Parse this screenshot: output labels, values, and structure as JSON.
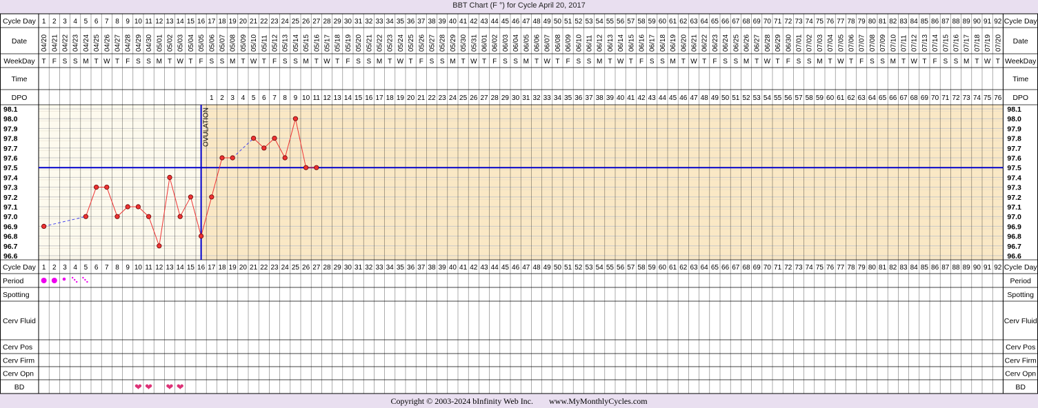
{
  "title": "BBT Chart (F °) for Cycle April 20, 2017",
  "footer": {
    "copyright": "Copyright © 2003-2024 bInfinity Web Inc.",
    "site": "www.MyMonthlyCycles.com"
  },
  "row_labels": {
    "cycle_day": "Cycle Day",
    "date": "Date",
    "weekday": "WeekDay",
    "time": "Time",
    "dpo": "DPO",
    "period": "Period",
    "spotting": "Spotting",
    "cerv_fluid": "Cerv Fluid",
    "cerv_pos": "Cerv Pos",
    "cerv_firm": "Cerv Firm",
    "cerv_opn": "Cerv Opn",
    "bd": "BD"
  },
  "ovulation_label": "OVULATION",
  "colors": {
    "background": "#e9dff0",
    "pre_ovulation_bg": "#fdfaee",
    "post_ovulation_bg": "#fae8c5",
    "grid": "#c8c8c8",
    "temp_line": "#ee3333",
    "coverline": "#0000cc",
    "ovulation_line": "#0000cc",
    "period_dot": "#ee00ee",
    "bd_heart": "#dd3377",
    "missing_link": "#4444ee"
  },
  "chart_data": {
    "type": "line",
    "x_label": "Cycle Day",
    "cycle_days": [
      1,
      2,
      3,
      4,
      5,
      6,
      7,
      8,
      9,
      10,
      11,
      12,
      13,
      14,
      15,
      16,
      17,
      18,
      19,
      20,
      21,
      22,
      23,
      24,
      25,
      26,
      27,
      28,
      29,
      30,
      31,
      32,
      33,
      34,
      35,
      36,
      37,
      38,
      39,
      40,
      41,
      42,
      43,
      44,
      45,
      46,
      47,
      48,
      49,
      50,
      51,
      52,
      53,
      54,
      55,
      56,
      57,
      58,
      59,
      60,
      61,
      62,
      63,
      64,
      65,
      66,
      67,
      68,
      69,
      70,
      71,
      72,
      73,
      74,
      75,
      76,
      77,
      78,
      79,
      80,
      81,
      82,
      83,
      84,
      85,
      86,
      87,
      88,
      89,
      90,
      91,
      92
    ],
    "dates": [
      "04/20",
      "04/21",
      "04/22",
      "04/23",
      "04/24",
      "04/25",
      "04/26",
      "04/27",
      "04/28",
      "04/29",
      "04/30",
      "05/01",
      "05/02",
      "05/03",
      "05/04",
      "05/05",
      "05/06",
      "05/07",
      "05/08",
      "05/09",
      "05/10",
      "05/11",
      "05/12",
      "05/13",
      "05/14",
      "05/15",
      "05/16",
      "05/17",
      "05/18",
      "05/19",
      "05/20",
      "05/21",
      "05/22",
      "05/23",
      "05/24",
      "05/25",
      "05/26",
      "05/27",
      "05/28",
      "05/29",
      "05/30",
      "05/31",
      "06/01",
      "06/02",
      "06/03",
      "06/04",
      "06/05",
      "06/06",
      "06/07",
      "06/08",
      "06/09",
      "06/10",
      "06/11",
      "06/12",
      "06/13",
      "06/14",
      "06/15",
      "06/16",
      "06/17",
      "06/18",
      "06/19",
      "06/20",
      "06/21",
      "06/22",
      "06/23",
      "06/24",
      "06/25",
      "06/26",
      "06/27",
      "06/28",
      "06/29",
      "06/30",
      "07/01",
      "07/02",
      "07/03",
      "07/04",
      "07/05",
      "07/06",
      "07/07",
      "07/08",
      "07/09",
      "07/10",
      "07/11",
      "07/12",
      "07/13",
      "07/14",
      "07/15",
      "07/16",
      "07/17",
      "07/18",
      "07/19",
      "07/20"
    ],
    "weekdays": [
      "T",
      "F",
      "S",
      "S",
      "M",
      "T",
      "W",
      "T",
      "F",
      "S",
      "S",
      "M",
      "T",
      "W",
      "T",
      "F",
      "S",
      "S",
      "M",
      "T",
      "W",
      "T",
      "F",
      "S",
      "S",
      "M",
      "T",
      "W",
      "T",
      "F",
      "S",
      "S",
      "M",
      "T",
      "W",
      "T",
      "F",
      "S",
      "S",
      "M",
      "T",
      "W",
      "T",
      "F",
      "S",
      "S",
      "M",
      "T",
      "W",
      "T",
      "F",
      "S",
      "S",
      "M",
      "T",
      "W",
      "T",
      "F",
      "S",
      "S",
      "M",
      "T",
      "W",
      "T",
      "F",
      "S",
      "S",
      "M",
      "T",
      "W",
      "T",
      "F",
      "S",
      "S",
      "M",
      "T",
      "W",
      "T",
      "F",
      "S",
      "S",
      "M",
      "T",
      "W",
      "T",
      "F",
      "S",
      "S",
      "M",
      "T",
      "W",
      "T"
    ],
    "dpo_start_day": 17,
    "dpo_end": 76,
    "y_ticks": [
      "98.1",
      "98.0",
      "97.9",
      "97.8",
      "97.7",
      "97.6",
      "97.5",
      "97.4",
      "97.3",
      "97.2",
      "97.1",
      "97.0",
      "96.9",
      "96.8",
      "96.7",
      "96.6"
    ],
    "ylim": [
      96.6,
      98.1
    ],
    "temps": [
      {
        "day": 1,
        "temp": 96.9
      },
      {
        "day": 5,
        "temp": 97.0
      },
      {
        "day": 6,
        "temp": 97.3
      },
      {
        "day": 7,
        "temp": 97.3
      },
      {
        "day": 8,
        "temp": 97.0
      },
      {
        "day": 9,
        "temp": 97.1
      },
      {
        "day": 10,
        "temp": 97.1
      },
      {
        "day": 11,
        "temp": 97.0
      },
      {
        "day": 12,
        "temp": 96.7
      },
      {
        "day": 13,
        "temp": 97.4
      },
      {
        "day": 14,
        "temp": 97.0
      },
      {
        "day": 15,
        "temp": 97.2
      },
      {
        "day": 16,
        "temp": 96.8
      },
      {
        "day": 17,
        "temp": 97.2
      },
      {
        "day": 18,
        "temp": 97.6
      },
      {
        "day": 19,
        "temp": 97.6
      },
      {
        "day": 21,
        "temp": 97.8
      },
      {
        "day": 22,
        "temp": 97.7
      },
      {
        "day": 23,
        "temp": 97.8
      },
      {
        "day": 24,
        "temp": 97.6
      },
      {
        "day": 25,
        "temp": 98.0
      },
      {
        "day": 26,
        "temp": 97.5
      },
      {
        "day": 27,
        "temp": 97.5
      }
    ],
    "coverline": 97.5,
    "ovulation_day": 16,
    "period": [
      {
        "day": 1,
        "level": "heavy"
      },
      {
        "day": 2,
        "level": "heavy"
      },
      {
        "day": 3,
        "level": "light"
      },
      {
        "day": 4,
        "level": "spotting"
      },
      {
        "day": 5,
        "level": "spotting"
      }
    ],
    "bd_days": [
      10,
      11,
      13,
      14
    ]
  }
}
